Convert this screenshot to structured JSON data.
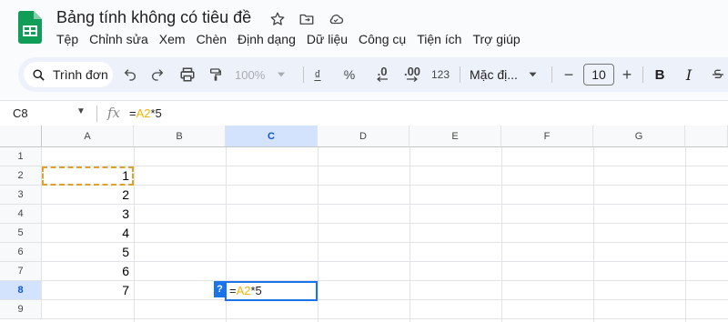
{
  "doc": {
    "title": "Bảng tính không có tiêu đề",
    "colors": {
      "brand": "#0f9d58",
      "accent": "#1a73e8",
      "ref_highlight": "#f4b400"
    }
  },
  "title_icons": [
    "star-icon",
    "move-to-folder-icon",
    "cloud-saved-icon"
  ],
  "menu": [
    "Tệp",
    "Chỉnh sửa",
    "Xem",
    "Chèn",
    "Định dạng",
    "Dữ liệu",
    "Công cụ",
    "Tiện ích",
    "Trợ giúp"
  ],
  "toolbar": {
    "search_label": "Trình đơn",
    "zoom": "100%",
    "currency": "₫",
    "percent": "%",
    "dec_decrease": ".0",
    "dec_increase": ".00",
    "number_format": "123",
    "font_name": "Mặc đị...",
    "font_size": "10",
    "minus": "−",
    "plus": "+",
    "bold": "B",
    "italic": "I"
  },
  "formula_bar": {
    "name_box": "C8",
    "fx": "fx",
    "formula_eq": "=",
    "formula_ref": "A2",
    "formula_rest": "*5"
  },
  "columns": [
    "A",
    "B",
    "C",
    "D",
    "E",
    "F",
    "G"
  ],
  "rows": [
    "1",
    "2",
    "3",
    "4",
    "5",
    "6",
    "7",
    "8",
    "9"
  ],
  "cells": {
    "A2": "1",
    "A3": "2",
    "A4": "3",
    "A5": "4",
    "A6": "5",
    "A7": "6",
    "A8": "7"
  },
  "editor": {
    "eq": "=",
    "ref": "A2",
    "rest": "*5",
    "help": "?"
  },
  "selected": {
    "column": "C",
    "row": "8"
  }
}
